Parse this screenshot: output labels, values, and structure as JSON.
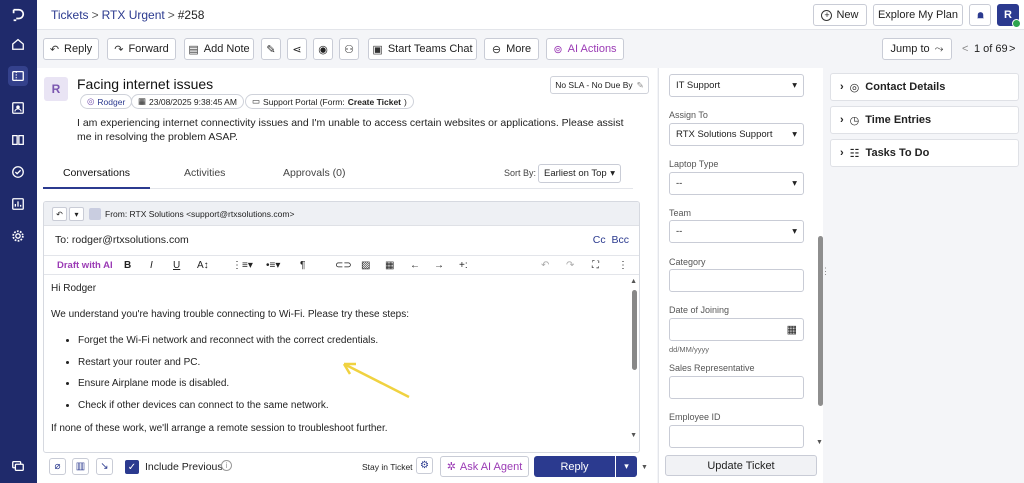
{
  "breadcrumb": {
    "part1": "Tickets",
    "part2": "RTX Urgent",
    "ticket_id": "#258"
  },
  "topbar": {
    "new_label": "New",
    "plan_label": "Explore My Plan",
    "user_initial": "R"
  },
  "toolbar": {
    "reply": "Reply",
    "forward": "Forward",
    "add_note": "Add Note",
    "teams_chat": "Start Teams Chat",
    "more": "More",
    "ai_actions": "AI Actions",
    "jump_to": "Jump to",
    "pagination": "1 of 69"
  },
  "ticket": {
    "avatar": "R",
    "title": "Facing internet issues",
    "requester": "Rodger",
    "date": "23/08/2025 9:38:45 AM",
    "source_prefix": "Support Portal (Form: ",
    "source_form": "Create Ticket",
    "source_suffix": ")",
    "sla": "No SLA - No Due By",
    "description": "I am experiencing internet connectivity issues and I'm unable to access certain websites or applications. Please assist me in resolving the problem ASAP."
  },
  "tabs": {
    "conversations": "Conversations",
    "activities": "Activities",
    "approvals": "Approvals (0)"
  },
  "sort": {
    "label": "Sort By:",
    "value": "Earliest on Top"
  },
  "compose": {
    "from": "From:  RTX Solutions <support@rtxsolutions.com>",
    "to": "To: rodger@rtxsolutions.com",
    "cc": "Cc",
    "bcc": "Bcc",
    "draft_ai": "Draft with AI",
    "greeting": "Hi Rodger",
    "intro": "We understand you're having trouble connecting to Wi-Fi. Please try these steps:",
    "steps": [
      "Forget the Wi-Fi network and reconnect with the correct credentials.",
      "Restart your router and PC.",
      "Ensure Airplane mode is disabled.",
      "Check if other devices can connect to the same network."
    ],
    "closing": "If none of these work, we'll arrange a remote session to troubleshoot further."
  },
  "bottom": {
    "include_previous": "Include Previous",
    "stay_in_ticket": "Stay in Ticket",
    "ask_ai": "Ask AI Agent",
    "reply": "Reply"
  },
  "fields": {
    "group_value": "IT Support",
    "assign_label": "Assign To",
    "assign_value": "RTX Solutions Support",
    "laptop_label": "Laptop Type",
    "laptop_value": "--",
    "team_label": "Team",
    "team_value": "--",
    "category_label": "Category",
    "doj_label": "Date of Joining",
    "doj_hint": "dd/MM/yyyy",
    "sales_label": "Sales Representative",
    "emp_label": "Employee ID",
    "update": "Update Ticket"
  },
  "panel": {
    "contact": "Contact Details",
    "time": "Time Entries",
    "tasks": "Tasks To Do"
  },
  "colors": {
    "brand": "#2b3a8f",
    "rail": "#1f2a6b",
    "ai": "#9b3bb5",
    "arrow": "#f0d240"
  }
}
